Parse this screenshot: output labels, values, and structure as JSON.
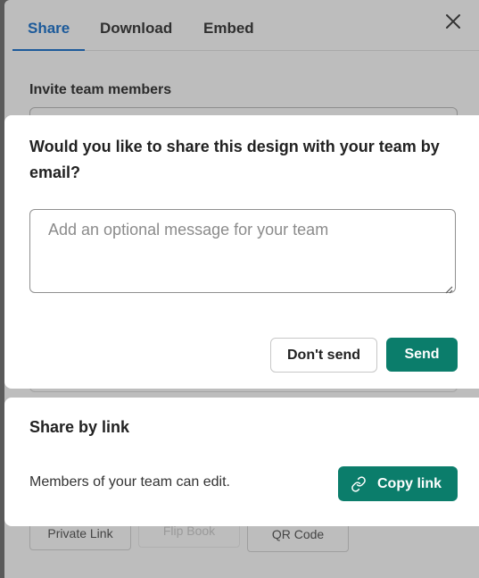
{
  "tabs": [
    {
      "label": "Share"
    },
    {
      "label": "Download"
    },
    {
      "label": "Embed"
    }
  ],
  "close_icon": "close-icon",
  "background": {
    "invite_heading": "Invite team members",
    "buttons": [
      {
        "label": "Private Link"
      },
      {
        "label": "Flip Book"
      },
      {
        "label": "QR Code"
      }
    ]
  },
  "dialog": {
    "question": "Would you like to share this design with your team by email?",
    "message_placeholder": "Add an optional message for your team",
    "message_value": "",
    "dont_send_label": "Don't send",
    "send_label": "Send"
  },
  "share_link": {
    "title": "Share by link",
    "description": "Members of your team can edit.",
    "copy_label": "Copy link",
    "icon": "link-icon"
  },
  "colors": {
    "accent": "#0b7d6b",
    "tab_active": "#1c5a9a"
  }
}
